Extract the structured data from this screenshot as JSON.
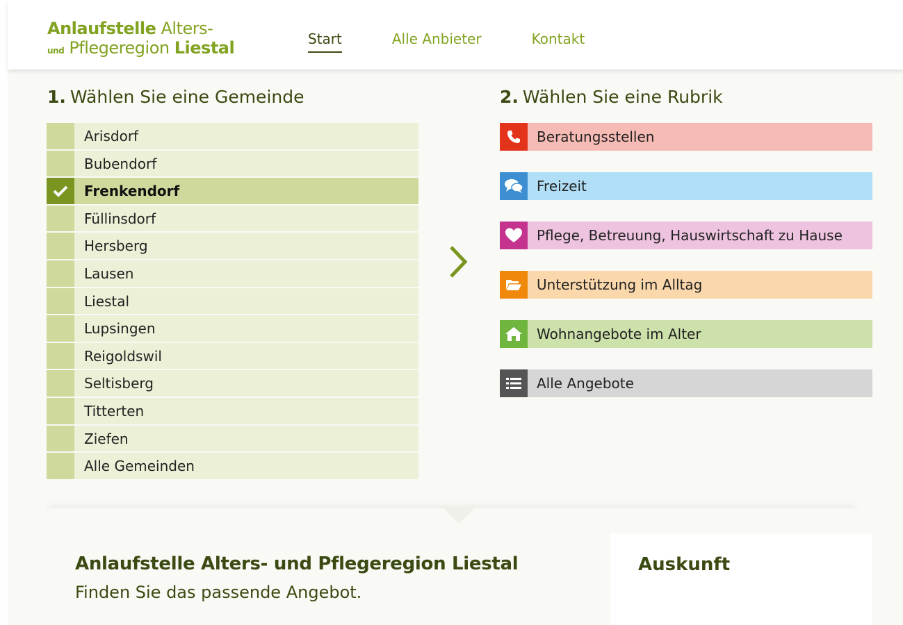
{
  "header": {
    "logo": {
      "line1_bold": "Anlaufstelle",
      "line1_rest": "Alters-",
      "line2_small": "und",
      "line2_normal": "Pflegeregion",
      "line2_bold": "Liestal"
    },
    "nav": [
      "Start",
      "Alle Anbieter",
      "Kontakt"
    ],
    "nav_active": "Start"
  },
  "step1": {
    "num": "1.",
    "title": "Wählen Sie eine Gemeinde"
  },
  "step2": {
    "num": "2.",
    "title": "Wählen Sie eine Rubrik"
  },
  "gemeinden": [
    "Arisdorf",
    "Bubendorf",
    "Frenkendorf",
    "Füllinsdorf",
    "Hersberg",
    "Lausen",
    "Liestal",
    "Lupsingen",
    "Reigoldswil",
    "Seltisberg",
    "Titterten",
    "Ziefen",
    "Alle Gemeinden"
  ],
  "selected_gemeinde": "Frenkendorf",
  "rubriken": [
    {
      "label": "Beratungsstellen",
      "icon": "phone-icon",
      "icon_color": "#e3341b",
      "bg": "#f7bbb5"
    },
    {
      "label": "Freizeit",
      "icon": "chat-bubbles-icon",
      "icon_color": "#3d8fd1",
      "bg": "#b0dff7"
    },
    {
      "label": "Pflege, Betreuung, Hauswirtschaft zu Hause",
      "icon": "heart-icon",
      "icon_color": "#c4348f",
      "bg": "#eec3df"
    },
    {
      "label": "Unterstützung im Alltag",
      "icon": "folder-open-icon",
      "icon_color": "#f0880c",
      "bg": "#fbd8ab"
    },
    {
      "label": "Wohnangebote im Alter",
      "icon": "home-icon",
      "icon_color": "#70b63e",
      "bg": "#cde2aa"
    },
    {
      "label": "Alle Angebote",
      "icon": "list-icon",
      "icon_color": "#555555",
      "bg": "#d6d6d6"
    }
  ],
  "intro": {
    "title": "Anlaufstelle Alters- und Pflegeregion Liestal",
    "subtitle": "Finden Sie das passende Angebot."
  },
  "info_card": {
    "title": "Auskunft"
  }
}
